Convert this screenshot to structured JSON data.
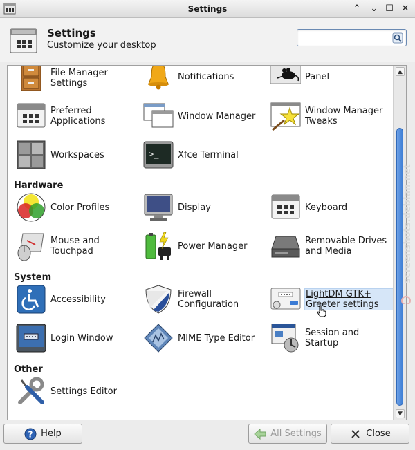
{
  "window": {
    "title": "Settings"
  },
  "header": {
    "title": "Settings",
    "subtitle": "Customize your desktop",
    "search_placeholder": ""
  },
  "sections": {
    "hardware": "Hardware",
    "system": "System",
    "other": "Other"
  },
  "items": {
    "file_manager": "File Manager Settings",
    "notifications": "Notifications",
    "panel": "Panel",
    "preferred_apps": "Preferred Applications",
    "window_manager": "Window Manager",
    "wm_tweaks": "Window Manager Tweaks",
    "workspaces": "Workspaces",
    "terminal": "Xfce Terminal",
    "color_profiles": "Color Profiles",
    "display": "Display",
    "keyboard": "Keyboard",
    "mouse": "Mouse and Touchpad",
    "power": "Power Manager",
    "removable": "Removable Drives and Media",
    "accessibility": "Accessibility",
    "firewall": "Firewall Configuration",
    "lightdm": "LightDM GTK+ Greeter settings",
    "login_window": "Login Window",
    "mime": "MIME Type Editor",
    "session": "Session and Startup",
    "settings_editor": "Settings Editor"
  },
  "footer": {
    "help": "Help",
    "all_settings": "All Settings",
    "close": "Close"
  },
  "watermark": "screenshots.debian.net"
}
